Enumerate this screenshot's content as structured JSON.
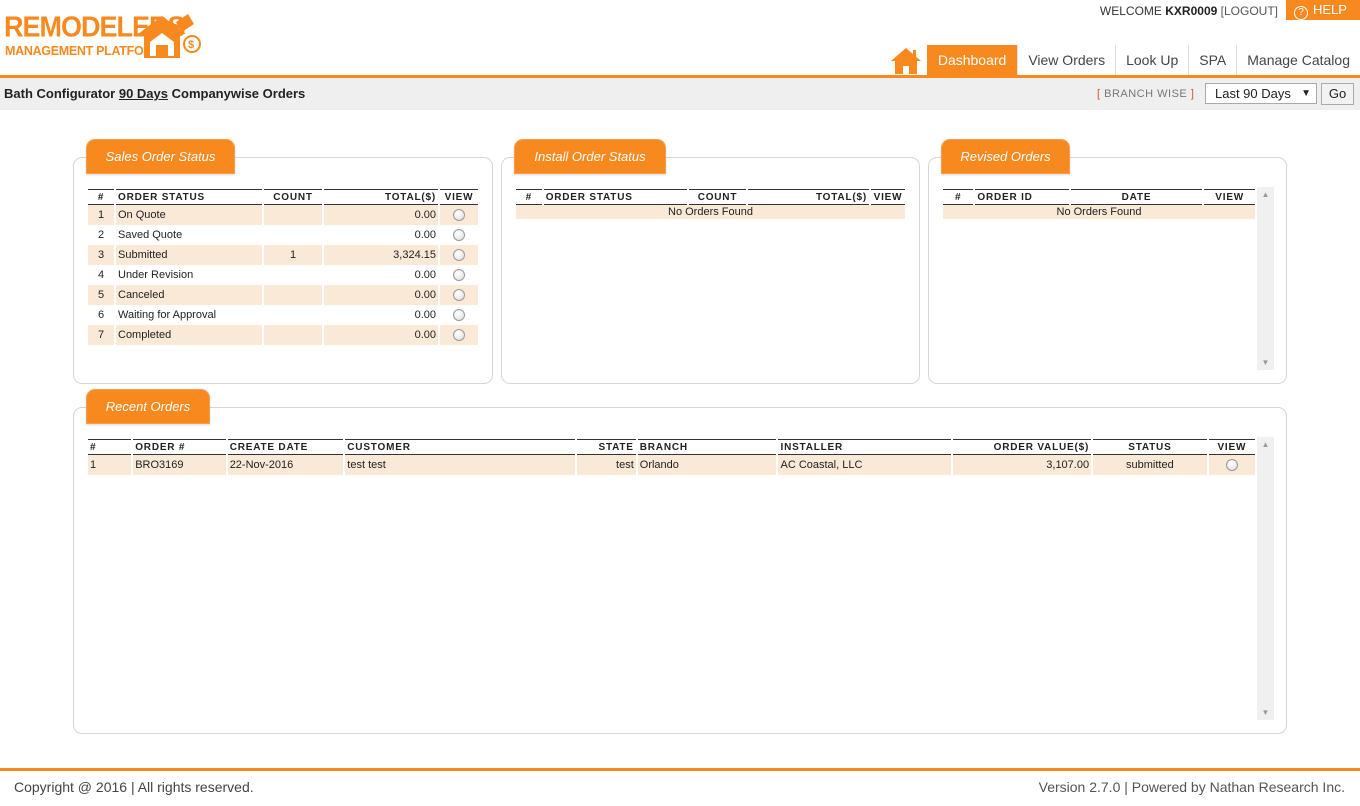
{
  "brand": {
    "line1": "REMODELERS",
    "line2": "MANAGEMENT PLATFORM",
    "color": "#f7891f"
  },
  "user": {
    "welcome": "WELCOME",
    "id": "KXR0009",
    "logout": "LOGOUT"
  },
  "help": "HELP",
  "nav": {
    "home_icon": "home-icon",
    "tabs": [
      "Dashboard",
      "View Orders",
      "Look Up",
      "SPA",
      "Manage Catalog"
    ],
    "active": "Dashboard"
  },
  "subbar": {
    "title_pre": "Bath Configurator",
    "title_link": "90 Days",
    "title_post": "Companywise Orders",
    "branch_wise": "BRANCH WISE",
    "period": "Last 90 Days",
    "go": "Go"
  },
  "sales": {
    "title": "Sales Order Status",
    "headers": [
      "#",
      "ORDER STATUS",
      "COUNT",
      "TOTAL($)",
      "VIEW"
    ],
    "rows": [
      {
        "n": "1",
        "status": "On Quote",
        "count": "",
        "total": "0.00"
      },
      {
        "n": "2",
        "status": "Saved Quote",
        "count": "",
        "total": "0.00"
      },
      {
        "n": "3",
        "status": "Submitted",
        "count": "1",
        "total": "3,324.15"
      },
      {
        "n": "4",
        "status": "Under Revision",
        "count": "",
        "total": "0.00"
      },
      {
        "n": "5",
        "status": "Canceled",
        "count": "",
        "total": "0.00"
      },
      {
        "n": "6",
        "status": "Waiting for Approval",
        "count": "",
        "total": "0.00"
      },
      {
        "n": "7",
        "status": "Completed",
        "count": "",
        "total": "0.00"
      }
    ]
  },
  "install": {
    "title": "Install Order Status",
    "headers": [
      "#",
      "ORDER STATUS",
      "COUNT",
      "TOTAL($)",
      "VIEW"
    ],
    "empty": "No Orders Found"
  },
  "revised": {
    "title": "Revised Orders",
    "headers": [
      "#",
      "ORDER ID",
      "DATE",
      "VIEW"
    ],
    "empty": "No Orders Found"
  },
  "recent": {
    "title": "Recent Orders",
    "headers": [
      "#",
      "ORDER #",
      "CREATE DATE",
      "CUSTOMER",
      "STATE",
      "BRANCH",
      "INSTALLER",
      "ORDER VALUE($)",
      "STATUS",
      "VIEW"
    ],
    "rows": [
      {
        "n": "1",
        "order": "BRO3169",
        "date": "22-Nov-2016",
        "customer": "test test",
        "state": "test",
        "branch": "Orlando",
        "installer": "AC Coastal, LLC",
        "value": "3,107.00",
        "status": "submitted"
      }
    ]
  },
  "footer": {
    "copyright": "Copyright @ 2016 | All rights reserved.",
    "version": "Version 2.7.0 | Powered by Nathan Research Inc."
  }
}
